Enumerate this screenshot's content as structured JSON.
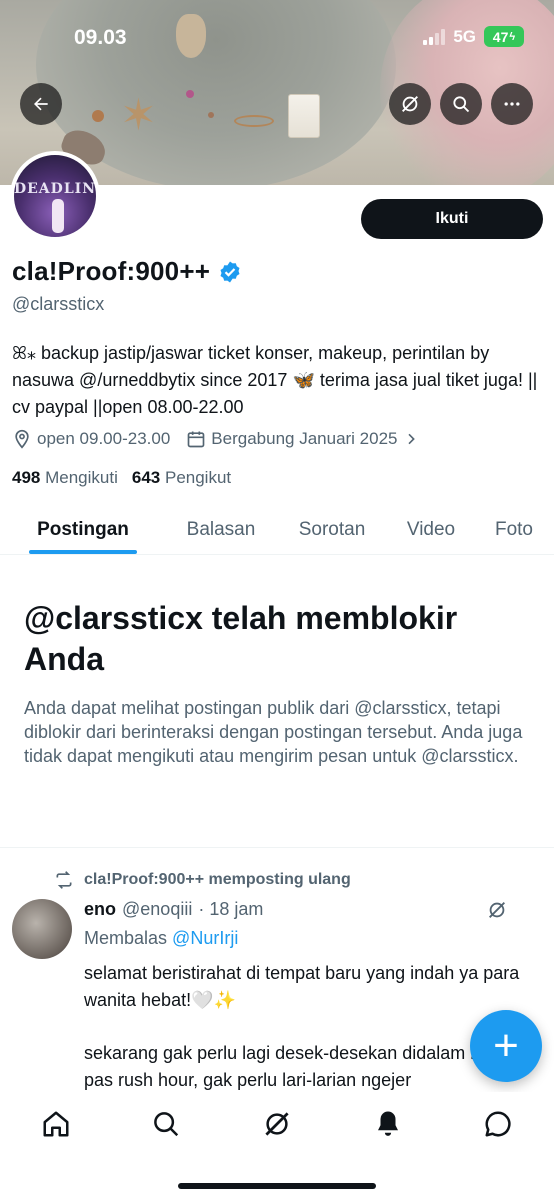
{
  "status_bar": {
    "time": "09.03",
    "network": "5G",
    "battery": "47"
  },
  "header": {
    "back_icon": "arrow-left-icon",
    "grok_icon": "grok-icon",
    "search_icon": "search-icon",
    "more_icon": "more-horizontal-icon"
  },
  "profile": {
    "avatar_text": "DEADLINE",
    "follow_label": "Ikuti",
    "name": "cla!Proof:900++",
    "handle": "@clarssticx",
    "bio": "ꕤ⁎ backup jastip/jaswar ticket konser, makeup, perintilan by nasuwa @/urneddbytix since 2017 🦋 terima jasa jual tiket juga! || cv paypal ||open 08.00-22.00",
    "location": "open 09.00-23.00",
    "joined": "Bergabung Januari 2025",
    "following_count": "498",
    "following_label": "Mengikuti",
    "followers_count": "643",
    "followers_label": "Pengikut"
  },
  "tabs": [
    {
      "label": "Postingan",
      "active": true
    },
    {
      "label": "Balasan"
    },
    {
      "label": "Sorotan"
    },
    {
      "label": "Video"
    },
    {
      "label": "Foto"
    }
  ],
  "blocked": {
    "title": "@clarssticx telah memblokir Anda",
    "message": "Anda dapat melihat postingan publik dari @clarssticx, tetapi diblokir dari berinteraksi dengan postingan tersebut. Anda juga tidak dapat mengikuti atau mengirim pesan untuk @clarssticx."
  },
  "tweet": {
    "repost_label": "cla!Proof:900++ memposting ulang",
    "author_name": "eno",
    "author_handle": "@enoqiii",
    "time": "· 18 jam",
    "reply_prefix": "Membalas",
    "reply_to": "@NurIrji",
    "text_1": "selamat beristirahat di tempat baru yang indah ya para wanita hebat!🤍✨",
    "text_2": "sekarang gak perlu lagi desek-desekan didalam kereta pas rush hour, gak perlu lari-larian ngejer"
  },
  "fab": {
    "icon": "plus-icon",
    "label": "+"
  },
  "bottom_nav": [
    "home-icon",
    "search-icon",
    "grok-icon",
    "notifications-icon",
    "messages-icon"
  ],
  "colors": {
    "accent": "#1d9bf0",
    "text": "#0f1419",
    "secondary": "#536471",
    "battery": "#34c759"
  }
}
